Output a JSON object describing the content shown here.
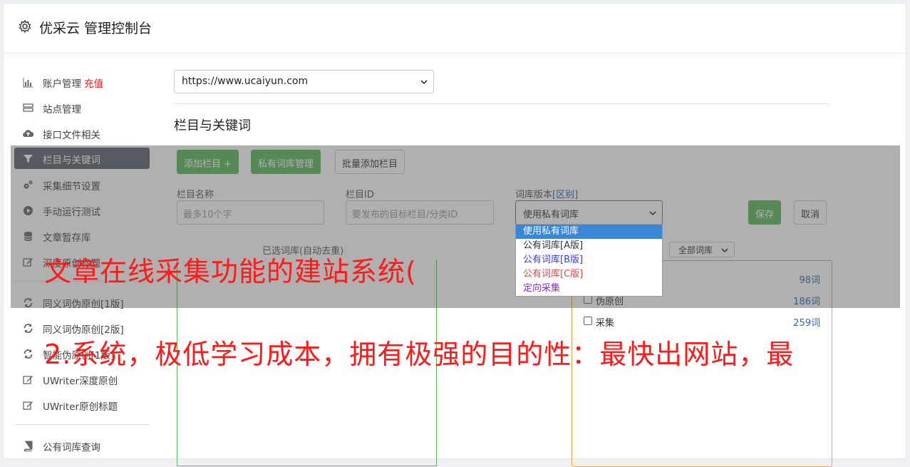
{
  "header": {
    "title": "优采云 管理控制台",
    "icon": "gear-icon"
  },
  "sidebar": {
    "items": [
      {
        "label": "账户管理",
        "badge": "充值",
        "icon": "bar-chart-icon"
      },
      {
        "label": "站点管理",
        "icon": "server-icon"
      },
      {
        "label": "接口文件相关",
        "icon": "cloud-upload-icon"
      },
      {
        "label": "栏目与关键词",
        "icon": "filter-icon",
        "active": true
      },
      {
        "label": "采集细节设置",
        "icon": "gears-icon"
      },
      {
        "label": "手动运行测试",
        "icon": "play-circle-icon"
      },
      {
        "label": "文章暂存库",
        "icon": "database-icon"
      },
      {
        "label": "深度原创标题",
        "icon": "edit-icon"
      },
      {
        "label": "同义词伪原创[1版]",
        "icon": "refresh-icon"
      },
      {
        "label": "同义词伪原创[2版]",
        "icon": "refresh-icon"
      },
      {
        "label": "智能伪原创[1版]",
        "icon": "refresh-icon"
      },
      {
        "label": "UWriter深度原创",
        "icon": "edit-icon"
      },
      {
        "label": "UWriter原创标题",
        "icon": "edit-icon"
      },
      {
        "label": "公有词库查询",
        "icon": "book-icon"
      }
    ]
  },
  "main": {
    "site_select": "https://www.ucaiyun.com",
    "section_title": "栏目与关键词",
    "buttons": {
      "add_column": "添加栏目 +",
      "private_lib": "私有词库管理",
      "batch_add": "批量添加栏目"
    },
    "form": {
      "name_label": "栏目名称",
      "name_placeholder": "最多10个字",
      "id_label": "栏目ID",
      "id_placeholder": "要发布的目标栏目/分类ID",
      "version_label": "词库版本",
      "version_link": "[区别]",
      "version_value": "使用私有词库",
      "save": "保存",
      "cancel": "取消"
    },
    "dropdown_options": [
      {
        "label": "使用私有词库",
        "color": "#ffffff",
        "selected": true
      },
      {
        "label": "公有词库[A版]",
        "color": "#333333"
      },
      {
        "label": "公有词库[B版]",
        "color": "#3a3ad8"
      },
      {
        "label": "公有词库[C版]",
        "color": "#d84a4a"
      },
      {
        "label": "定向采集",
        "color": "#8a2be2"
      }
    ],
    "keyword_label": "已选词库(自动去重)",
    "lib_filter": "全部词库",
    "libraries": [
      {
        "name": "",
        "count": "98词"
      },
      {
        "name": "伪原创",
        "count": "186词"
      },
      {
        "name": "采集",
        "count": "259词"
      }
    ]
  },
  "captions": {
    "line1": "文章在线采集功能的建站系统(",
    "line2": "2.系统，极低学习成本，拥有极强的目的性：最快出网站，最"
  },
  "colors": {
    "accent": "#5cb85c",
    "link": "#2a64c5",
    "caption": "#ff1a1a",
    "active_bg": "#5a6370"
  }
}
